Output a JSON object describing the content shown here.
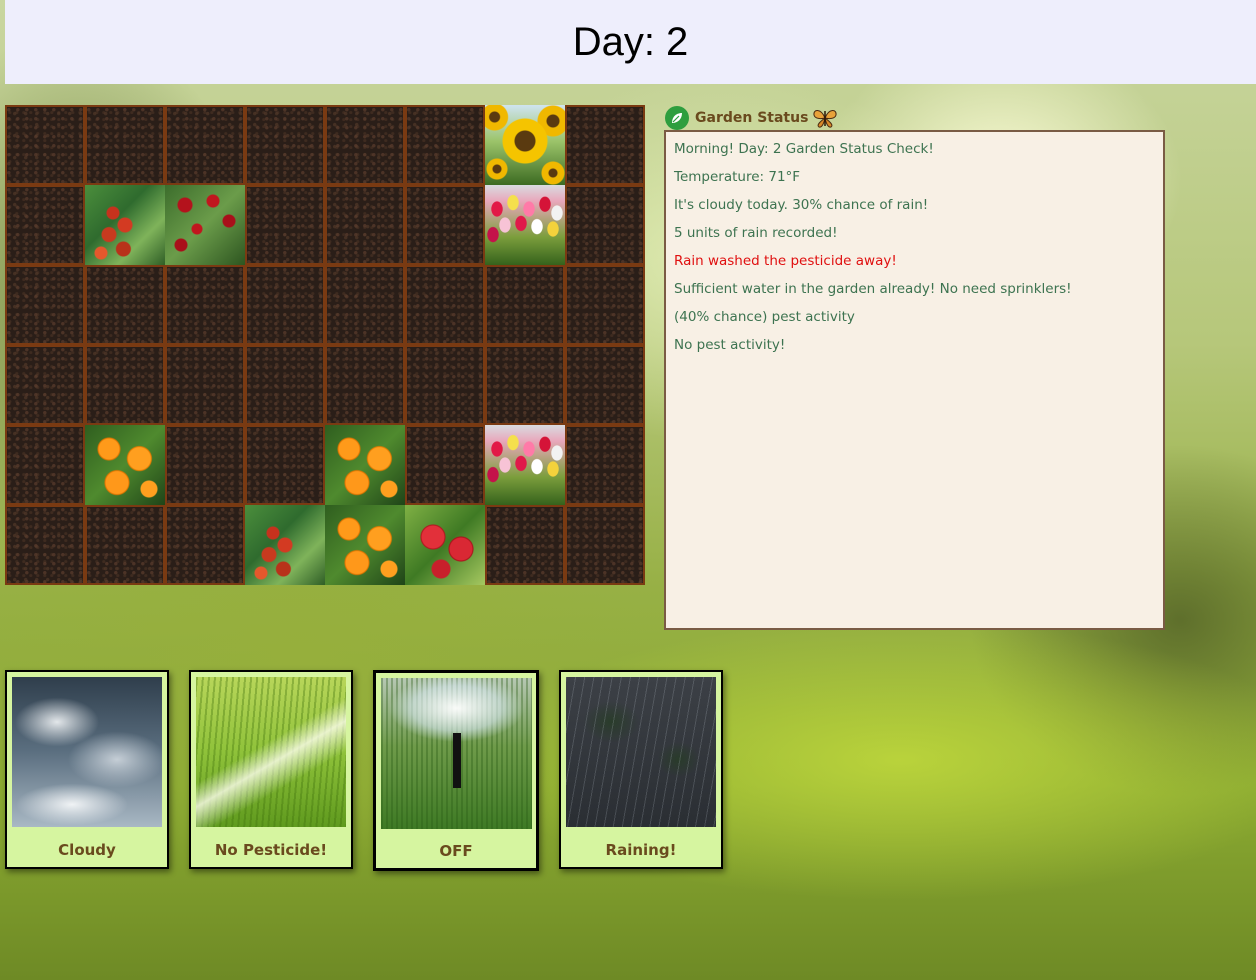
{
  "header": {
    "day_text": "Day: 2"
  },
  "garden": {
    "rows": 6,
    "cols": 8,
    "plants": [
      {
        "row": 0,
        "col": 6,
        "type": "sunflower"
      },
      {
        "row": 1,
        "col": 1,
        "type": "tomato"
      },
      {
        "row": 1,
        "col": 2,
        "type": "roses"
      },
      {
        "row": 1,
        "col": 6,
        "type": "tulips"
      },
      {
        "row": 4,
        "col": 1,
        "type": "oranges"
      },
      {
        "row": 4,
        "col": 4,
        "type": "oranges"
      },
      {
        "row": 4,
        "col": 6,
        "type": "tulips"
      },
      {
        "row": 5,
        "col": 3,
        "type": "tomato"
      },
      {
        "row": 5,
        "col": 4,
        "type": "oranges"
      },
      {
        "row": 5,
        "col": 5,
        "type": "apples"
      }
    ]
  },
  "status_panel": {
    "title": "Garden Status",
    "icons": [
      "leaf-icon",
      "butterfly-icon"
    ],
    "lines": [
      {
        "text": "Morning! Day: 2 Garden Status Check!",
        "alert": false
      },
      {
        "text": "Temperature: 71°F",
        "alert": false
      },
      {
        "text": "It's cloudy today. 30% chance of rain!",
        "alert": false
      },
      {
        "text": "5 units of rain recorded!",
        "alert": false
      },
      {
        "text": "Rain washed the pesticide away!",
        "alert": true
      },
      {
        "text": "Sufficient water in the garden already! No need sprinklers!",
        "alert": false
      },
      {
        "text": "(40% chance) pest activity",
        "alert": false
      },
      {
        "text": "No pest activity!",
        "alert": false
      }
    ],
    "colors": {
      "normal": "#3d7350",
      "alert": "#e01010"
    }
  },
  "cards": [
    {
      "id": "weather",
      "label": "Cloudy",
      "image": "cloudy-sky",
      "active": false
    },
    {
      "id": "pesticide",
      "label": "No Pesticide!",
      "image": "pesticide-spray",
      "active": false
    },
    {
      "id": "sprinkler",
      "label": "OFF",
      "image": "sprinkler",
      "active": true
    },
    {
      "id": "rain",
      "label": "Raining!",
      "image": "rain",
      "active": false
    }
  ]
}
